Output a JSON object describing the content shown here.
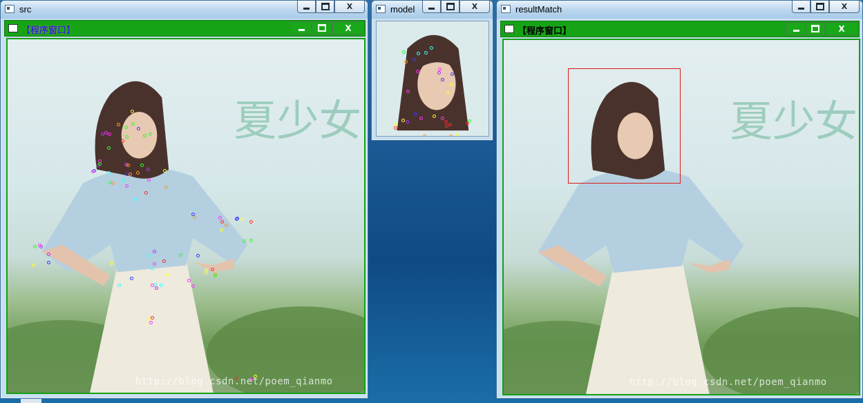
{
  "windows": {
    "src": {
      "title": "src",
      "inner_title": "【程序窗口】",
      "controls": [
        "minimize",
        "maximize",
        "close"
      ],
      "close_glyph": "X",
      "keypoint_colors": [
        "#ff2a2a",
        "#2cff2c",
        "#3a3aff",
        "#ffff33",
        "#ff33ff",
        "#33ffff",
        "#ff9922",
        "#aa33ff"
      ],
      "watermark": "http://blog.csdn.net/poem_qianmo"
    },
    "model": {
      "title": "model",
      "controls": [
        "minimize",
        "maximize",
        "close"
      ],
      "close_glyph": "X"
    },
    "resultMatch": {
      "title": "resultMatch",
      "inner_title": "【程序窗口】",
      "controls": [
        "minimize",
        "maximize",
        "close"
      ],
      "close_glyph": "X",
      "detection_box_color": "#e01818",
      "watermark": "http://blog.csdn.net/poem_qianmo"
    }
  },
  "photo": {
    "calligraphy": "夏少女"
  },
  "icons": {
    "title_icon": "window-app-icon",
    "minimize": "minimize-icon",
    "maximize": "maximize-icon",
    "close": "close-icon"
  }
}
